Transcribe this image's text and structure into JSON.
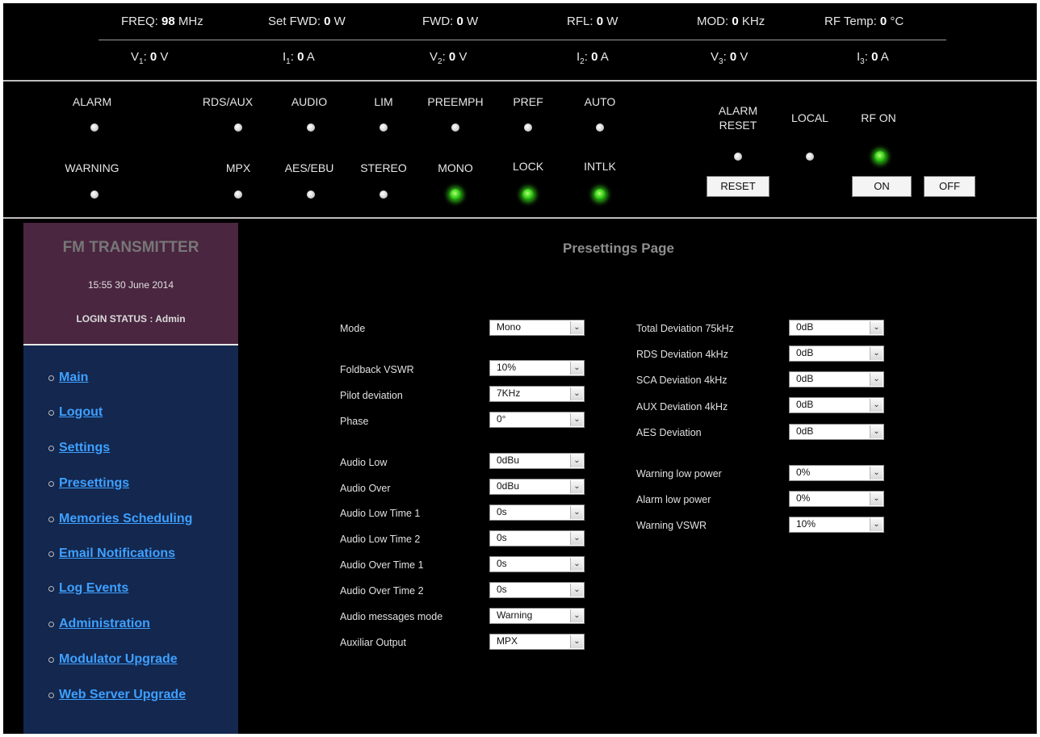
{
  "header": {
    "row1": [
      {
        "label": "FREQ: ",
        "value": "98",
        "unit": " MHz"
      },
      {
        "label": "Set FWD: ",
        "value": "0",
        "unit": " W"
      },
      {
        "label": "FWD: ",
        "value": "0",
        "unit": " W"
      },
      {
        "label": "RFL: ",
        "value": "0",
        "unit": " W"
      },
      {
        "label": "MOD: ",
        "value": "0",
        "unit": " KHz"
      },
      {
        "label": "RF Temp: ",
        "value": "0",
        "unit": " °C"
      }
    ],
    "row2": [
      {
        "label": "V",
        "sub": "1",
        "sep": ": ",
        "value": "0",
        "unit": " V"
      },
      {
        "label": "I",
        "sub": "1",
        "sep": ": ",
        "value": "0",
        "unit": " A"
      },
      {
        "label": "V",
        "sub": "2",
        "sep": ": ",
        "value": "0",
        "unit": " V"
      },
      {
        "label": "I",
        "sub": "2",
        "sep": ": ",
        "value": "0",
        "unit": " A"
      },
      {
        "label": "V",
        "sub": "3",
        "sep": ": ",
        "value": "0",
        "unit": " V"
      },
      {
        "label": "I",
        "sub": "3",
        "sep": ": ",
        "value": "0",
        "unit": " A"
      }
    ]
  },
  "status": {
    "row1": [
      {
        "label": "ALARM",
        "on": false
      },
      {
        "label": "RDS/AUX",
        "on": false
      },
      {
        "label": "AUDIO",
        "on": false
      },
      {
        "label": "LIM",
        "on": false
      },
      {
        "label": "PREEMPH",
        "on": false
      },
      {
        "label": "PREF",
        "on": false
      },
      {
        "label": "AUTO",
        "on": false
      }
    ],
    "row2": [
      {
        "label": "WARNING",
        "on": false
      },
      {
        "label": "MPX",
        "on": false
      },
      {
        "label": "AES/EBU",
        "on": false
      },
      {
        "label": "STEREO",
        "on": false
      },
      {
        "label": "MONO",
        "on": true
      },
      {
        "label": "LOCK",
        "on": true
      },
      {
        "label": "INTLK",
        "on": true
      }
    ],
    "controls": {
      "alarm_reset": {
        "label_line1": "ALARM",
        "label_line2": "RESET",
        "on": false,
        "button": "RESET"
      },
      "local": {
        "label": "LOCAL",
        "on": false
      },
      "rf_on": {
        "label": "RF ON",
        "on": true,
        "button_on": "ON",
        "button_off": "OFF"
      }
    }
  },
  "sidebar": {
    "title": "FM TRANSMITTER",
    "datetime": "15:55 30 June 2014",
    "login_status": "LOGIN STATUS : Admin",
    "nav": [
      "Main",
      "Logout",
      "Settings",
      "Presettings",
      "Memories Scheduling",
      "Email Notifications",
      "Log Events",
      "Administration",
      "Modulator Upgrade",
      "Web Server Upgrade"
    ]
  },
  "main": {
    "title": "Presettings Page",
    "left_fields": [
      {
        "label": "Mode",
        "value": "Mono"
      },
      {
        "label": "Foldback VSWR",
        "value": "10%"
      },
      {
        "label": "Pilot deviation",
        "value": "7KHz"
      },
      {
        "label": "Phase",
        "value": "0°"
      },
      {
        "label": "Audio Low",
        "value": "0dBu"
      },
      {
        "label": "Audio Over",
        "value": "0dBu"
      },
      {
        "label": "Audio Low Time 1",
        "value": "0s"
      },
      {
        "label": "Audio Low Time 2",
        "value": "0s"
      },
      {
        "label": "Audio Over Time 1",
        "value": "0s"
      },
      {
        "label": "Audio Over Time 2",
        "value": "0s"
      },
      {
        "label": "Audio messages mode",
        "value": "Warning"
      },
      {
        "label": "Auxiliar Output",
        "value": "MPX"
      }
    ],
    "right_fields": [
      {
        "label": "Total Deviation 75kHz",
        "value": "0dB"
      },
      {
        "label": "RDS Deviation 4kHz",
        "value": "0dB"
      },
      {
        "label": "SCA Deviation 4kHz",
        "value": "0dB"
      },
      {
        "label": "AUX Deviation 4kHz",
        "value": "0dB"
      },
      {
        "label": "AES Deviation",
        "value": "0dB"
      },
      {
        "label": "Warning low power",
        "value": "0%"
      },
      {
        "label": "Alarm low power",
        "value": "0%"
      },
      {
        "label": "Warning VSWR",
        "value": "10%"
      }
    ]
  }
}
